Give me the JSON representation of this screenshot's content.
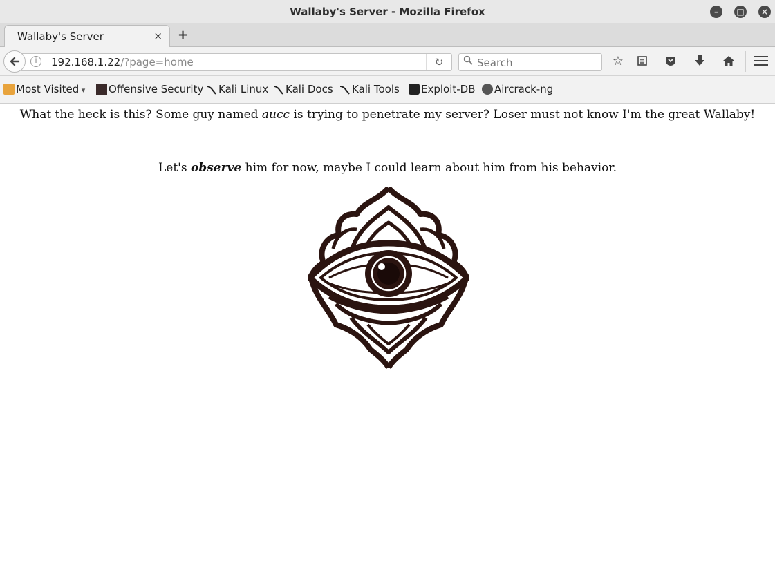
{
  "window": {
    "title": "Wallaby's Server - Mozilla Firefox",
    "controls": {
      "minimize": "–",
      "maximize": "□",
      "close": "×"
    }
  },
  "tabs": [
    {
      "label": "Wallaby's Server",
      "close": "×"
    }
  ],
  "new_tab_label": "+",
  "navbar": {
    "url_host": "192.168.1.22",
    "url_path": "/?page=home",
    "search_placeholder": "Search"
  },
  "bookmarks": [
    {
      "label": "Most Visited",
      "suffix": " ▾",
      "icon": "folder-icon"
    },
    {
      "label": "Offensive Security",
      "icon": "offensive-security-icon"
    },
    {
      "label": "Kali Linux",
      "icon": "kali-icon"
    },
    {
      "label": "Kali Docs",
      "icon": "kali-icon"
    },
    {
      "label": "Kali Tools",
      "icon": "kali-icon"
    },
    {
      "label": "Exploit-DB",
      "icon": "exploit-db-icon"
    },
    {
      "label": "Aircrack-ng",
      "icon": "aircrack-icon"
    }
  ],
  "page": {
    "line1_before": "What the heck is this? Some guy named ",
    "line1_em": "aucc",
    "line1_after": " is trying to penetrate my server? Loser must not know I'm the great Wallaby!",
    "line2_before": "Let's ",
    "line2_strong": "observe",
    "line2_after": " him for now, maybe I could learn about him from his behavior.",
    "image": "all-seeing-eye-illustration"
  },
  "colors": {
    "chrome_bg": "#f2f2f2",
    "titlebar_bg": "#e8e8e8",
    "eye_ink": "#2b1410"
  }
}
